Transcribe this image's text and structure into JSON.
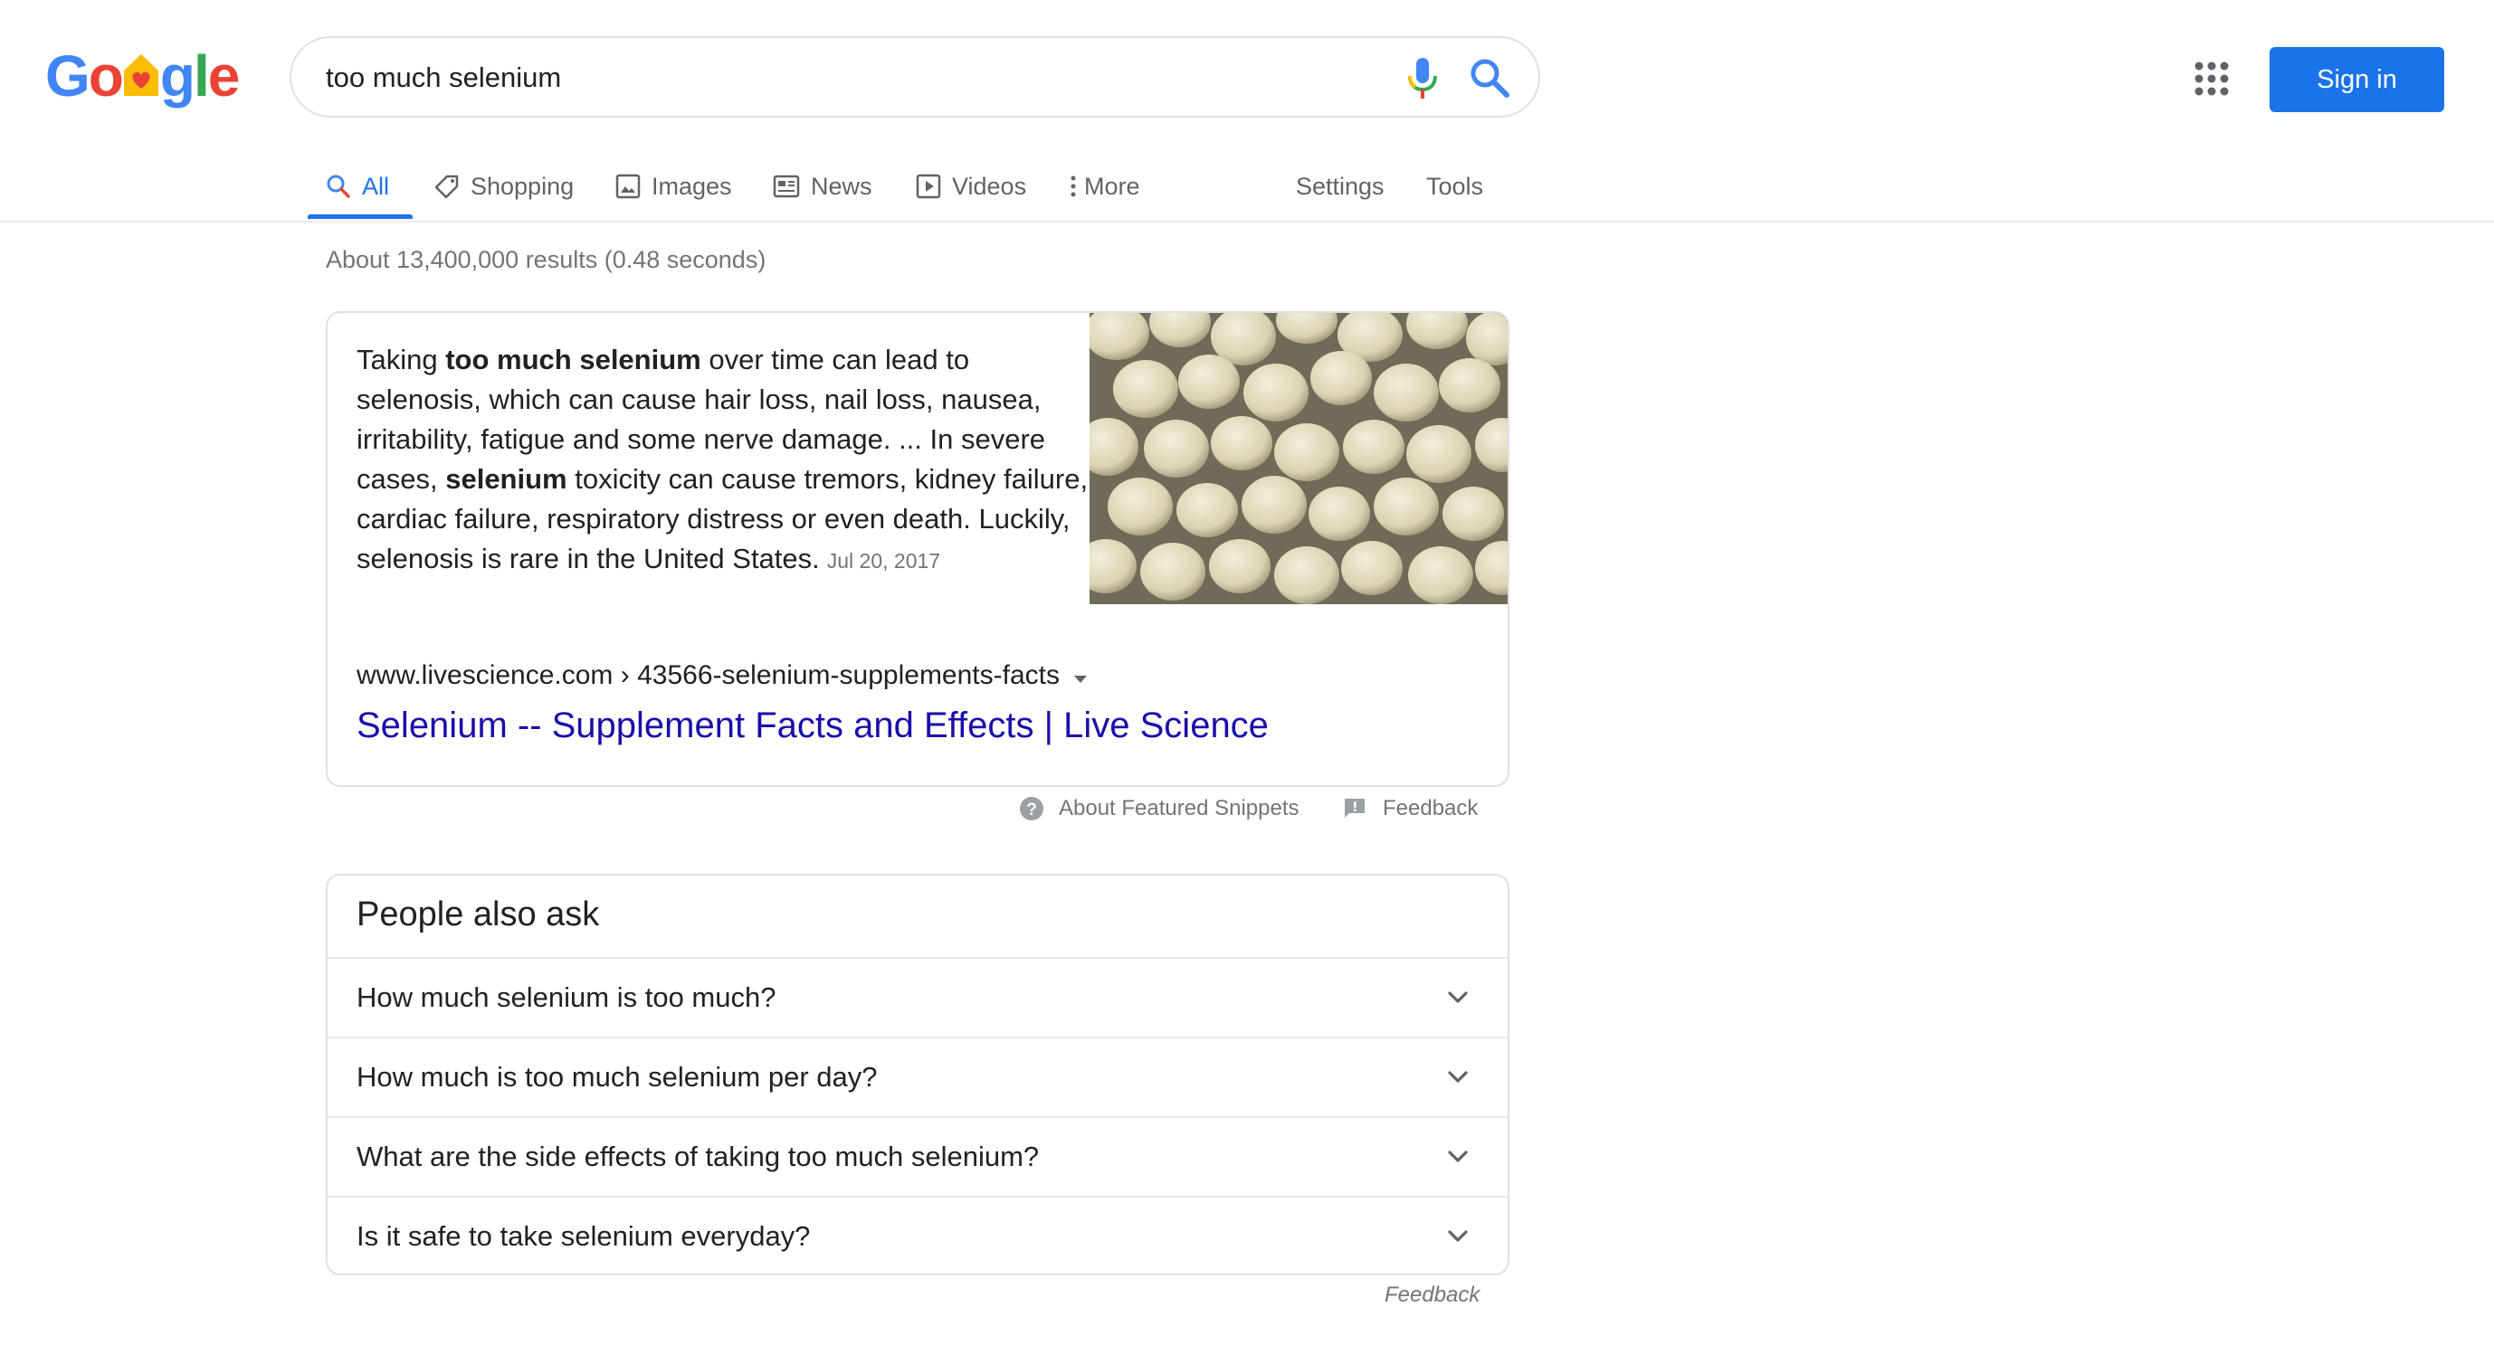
{
  "header": {
    "logo_letters": [
      "G",
      "o",
      "o",
      "g",
      "l",
      "e"
    ],
    "search_value": "too much selenium",
    "sign_in_label": "Sign in"
  },
  "tabs": {
    "all": "All",
    "shopping": "Shopping",
    "images": "Images",
    "news": "News",
    "videos": "Videos",
    "more": "More",
    "settings": "Settings",
    "tools": "Tools"
  },
  "result_stats": "About 13,400,000 results (0.48 seconds)",
  "featured_snippet": {
    "text_1": "Taking ",
    "bold_1": "too much selenium",
    "text_2": " over time can lead to selenosis, which can cause hair loss, nail loss, nausea, irritability, fatigue and some nerve damage. ... In severe cases, ",
    "bold_2": "selenium",
    "text_3": " toxicity can cause tremors, kidney failure, cardiac failure, respiratory distress or even death. Luckily, selenosis is rare in the United States.",
    "date": "Jul 20, 2017",
    "url": "www.livescience.com › 43566-selenium-supplements-facts",
    "title": "Selenium -- Supplement Facts and Effects | Live Science",
    "about_label": "About Featured Snippets",
    "feedback_label": "Feedback"
  },
  "people_also_ask": {
    "title": "People also ask",
    "questions": [
      "How much selenium is too much?",
      "How much is too much selenium per day?",
      "What are the side effects of taking too much selenium?",
      "Is it safe to take selenium everyday?"
    ],
    "feedback_label": "Feedback"
  },
  "colors": {
    "accent": "#1a73e8",
    "link": "#1a0dab",
    "muted": "#70757a"
  }
}
